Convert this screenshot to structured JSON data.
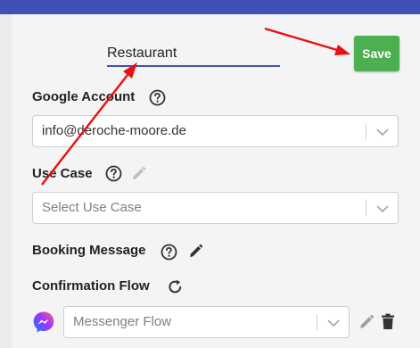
{
  "form": {
    "name_value": "Restaurant",
    "save_label": "Save",
    "google_account": {
      "label": "Google Account",
      "value": "info@deroche-moore.de"
    },
    "use_case": {
      "label": "Use Case",
      "placeholder": "Select Use Case"
    },
    "booking_message": {
      "label": "Booking Message"
    },
    "confirmation_flow": {
      "label": "Confirmation Flow",
      "placeholder": "Messenger Flow"
    }
  },
  "colors": {
    "header": "#3f51b5",
    "save_button": "#4caf50",
    "annotation_arrow": "#e81010"
  },
  "icons": [
    "help-icon",
    "pencil-icon",
    "refresh-icon",
    "chevron-down-icon",
    "messenger-icon",
    "trash-icon"
  ]
}
